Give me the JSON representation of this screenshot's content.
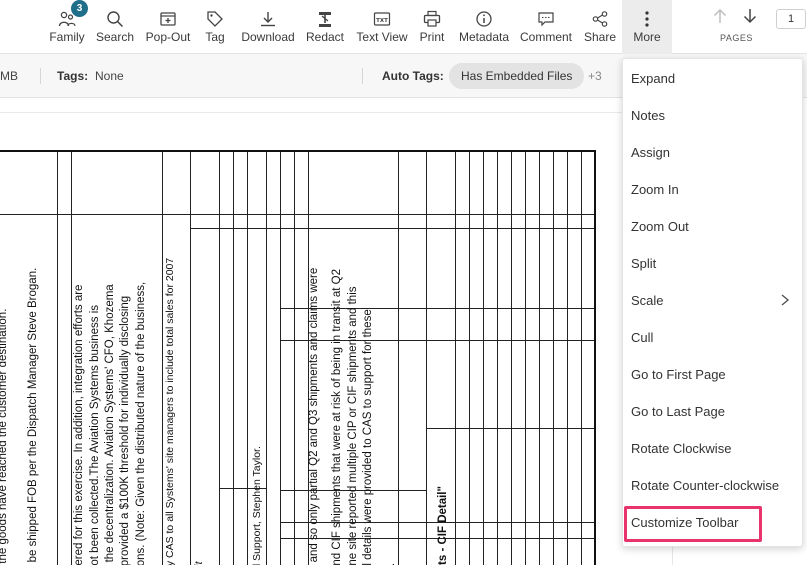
{
  "toolbar": {
    "family": {
      "label": "Family",
      "badge": "3",
      "icon": "family-icon"
    },
    "search": {
      "label": "Search",
      "icon": "search-icon"
    },
    "popout": {
      "label": "Pop-Out",
      "icon": "popout-icon"
    },
    "tag": {
      "label": "Tag",
      "icon": "tag-icon"
    },
    "download": {
      "label": "Download",
      "icon": "download-icon"
    },
    "redact": {
      "label": "Redact",
      "icon": "redact-icon"
    },
    "textview": {
      "label": "Text View",
      "icon": "text-view-icon"
    },
    "print": {
      "label": "Print",
      "icon": "print-icon"
    },
    "metadata": {
      "label": "Metadata",
      "icon": "info-icon"
    },
    "comment": {
      "label": "Comment",
      "icon": "comment-icon"
    },
    "share": {
      "label": "Share",
      "icon": "share-icon"
    },
    "more": {
      "label": "More",
      "icon": "more-vertical-icon"
    }
  },
  "pages": {
    "label": "PAGES",
    "current": "1"
  },
  "meta": {
    "size_fragment": "MB",
    "tags_label": "Tags:",
    "tags_value": "None",
    "auto_tags_label": "Auto Tags:",
    "auto_tag_chip": "Has Embedded Files",
    "auto_tags_more": "+3"
  },
  "document": {
    "col1": "il the goods have reached the customer destination.",
    "col2": "o be shipped FOB per the Dispatch Manager Steve Brogan.",
    "col3": "dered for this exercise.  In addition, integration efforts are",
    "col4": "not been collected.The Aviation Systems business is",
    "col5": "o the decentralization. Aviation Systems' CFO, Khozema",
    "col6": "l provided a $100K threshold for individually disclosing",
    "col7": "tions.  (Note: Given the distributed nature of the business,",
    "col8": "by CAS to all Systems' site managers to include total sales for 2007",
    "col9": "sit",
    "col10": "al Support, Stephen Taylor.",
    "col11": "7 and so only partial Q2 and Q3 shipments and claims were",
    "col12": "and CIF shipments that were at risk of being in transit at Q2",
    "col13": "one site reported multiple CIP or CIF shipments and this",
    "col14": "al details were provided to CAS to support for these",
    "col15": "s.",
    "col16": "nts - CIF Detail\""
  },
  "menu": {
    "items": [
      "Expand",
      "Notes",
      "Assign",
      "Zoom In",
      "Zoom Out",
      "Split",
      "Scale",
      "Cull",
      "Go to First Page",
      "Go to Last Page",
      "Rotate Clockwise",
      "Rotate Counter-clockwise",
      "Customize Toolbar"
    ]
  },
  "colors": {
    "badge": "#1f6f8b",
    "highlight": "#e8336d",
    "more_active_bg": "#ececec"
  }
}
